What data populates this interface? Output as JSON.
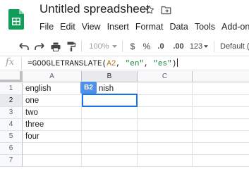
{
  "app": {
    "title": "Untitled spreadsheet",
    "brand_color": "#0f9d58"
  },
  "menu": {
    "items": [
      "File",
      "Edit",
      "View",
      "Insert",
      "Format",
      "Data",
      "Tools",
      "Add-ons"
    ]
  },
  "toolbar": {
    "zoom": "100%",
    "currency": "$",
    "percent": "%",
    "decrease_decimals": ".0",
    "increase_decimals": ".00",
    "more_formats": "123",
    "font": "Default (A"
  },
  "formula_bar": {
    "fx": "fx",
    "prefix": "=GOOGLETRANSLATE(",
    "ref": "A2",
    "sep1": ", ",
    "arg1": "\"en\"",
    "sep2": ", ",
    "arg2": "\"es\"",
    "suffix": ")"
  },
  "grid": {
    "corner": "",
    "columns": [
      "A",
      "B",
      "C"
    ],
    "rows": [
      "1",
      "2",
      "3",
      "4",
      "5",
      "6",
      "7"
    ],
    "column_a": [
      "english",
      "one",
      "two",
      "three",
      "four",
      "",
      ""
    ],
    "column_b": [
      "nish",
      "",
      "",
      "",
      "",
      "",
      ""
    ],
    "selected_cell": "B2"
  }
}
